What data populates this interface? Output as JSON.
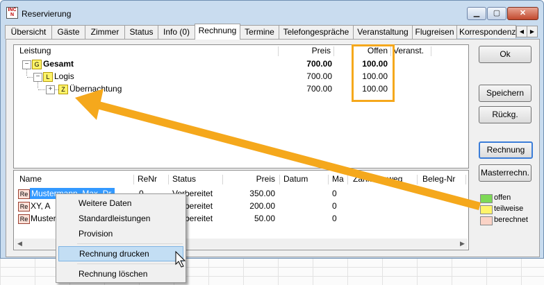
{
  "window": {
    "title": "Reservierung"
  },
  "tabs": [
    "Übersicht",
    "Gäste",
    "Zimmer",
    "Status",
    "Info (0)",
    "Rechnung",
    "Termine",
    "Telefongespräche",
    "Veranstaltung",
    "Flugreisen",
    "Korrespondenz"
  ],
  "active_tab": "Rechnung",
  "tree": {
    "columns": [
      "Leistung",
      "Preis",
      "Offen",
      "Veranst."
    ],
    "rows": [
      {
        "toggle": "−",
        "tag": "G",
        "label": "Gesamt",
        "preis": "700.00",
        "offen": "100.00",
        "bold": true
      },
      {
        "toggle": "−",
        "tag": "L",
        "label": "Logis",
        "preis": "700.00",
        "offen": "100.00",
        "bold": false
      },
      {
        "toggle": "+",
        "tag": "Z",
        "label": "Übernachtung",
        "preis": "700.00",
        "offen": "100.00",
        "bold": false
      }
    ]
  },
  "invoices": {
    "columns": [
      "Name",
      "ReNr",
      "Status",
      "Preis",
      "Datum",
      "Ma",
      "Zahlungsweg",
      "Beleg-Nr"
    ],
    "rows": [
      {
        "tag": "Re",
        "name": "Mustermann, Max, Dr.",
        "renr": "0",
        "status": "Vorbereitet",
        "preis": "350.00",
        "datum": "",
        "ma": "0"
      },
      {
        "tag": "Re",
        "name": "XY, A",
        "renr": "0",
        "status": "Vorbereitet",
        "preis": "200.00",
        "datum": "",
        "ma": "0"
      },
      {
        "tag": "Re",
        "name": "Mustermann",
        "renr": "0",
        "status": "Vorbereitet",
        "preis": "50.00",
        "datum": "",
        "ma": "0"
      }
    ]
  },
  "buttons": {
    "ok": "Ok",
    "speichern": "Speichern",
    "rueckg": "Rückg.",
    "rechnung": "Rechnung",
    "masterrechn": "Masterrechn."
  },
  "legend": [
    {
      "label": "offen",
      "color": "#7ed957"
    },
    {
      "label": "teilweise",
      "color": "#fff46a"
    },
    {
      "label": "berechnet",
      "color": "#fbd3c6"
    }
  ],
  "context_menu": {
    "items": [
      "Weitere Daten",
      "Standardleistungen",
      "Provision",
      "Rechnung drucken",
      "Rechnung löschen"
    ],
    "highlighted": "Rechnung drucken"
  },
  "colors": {
    "accent_arrow": "#f5a81c",
    "window_frame": "#c9dcef",
    "menu_highlight": "#c3def4"
  }
}
